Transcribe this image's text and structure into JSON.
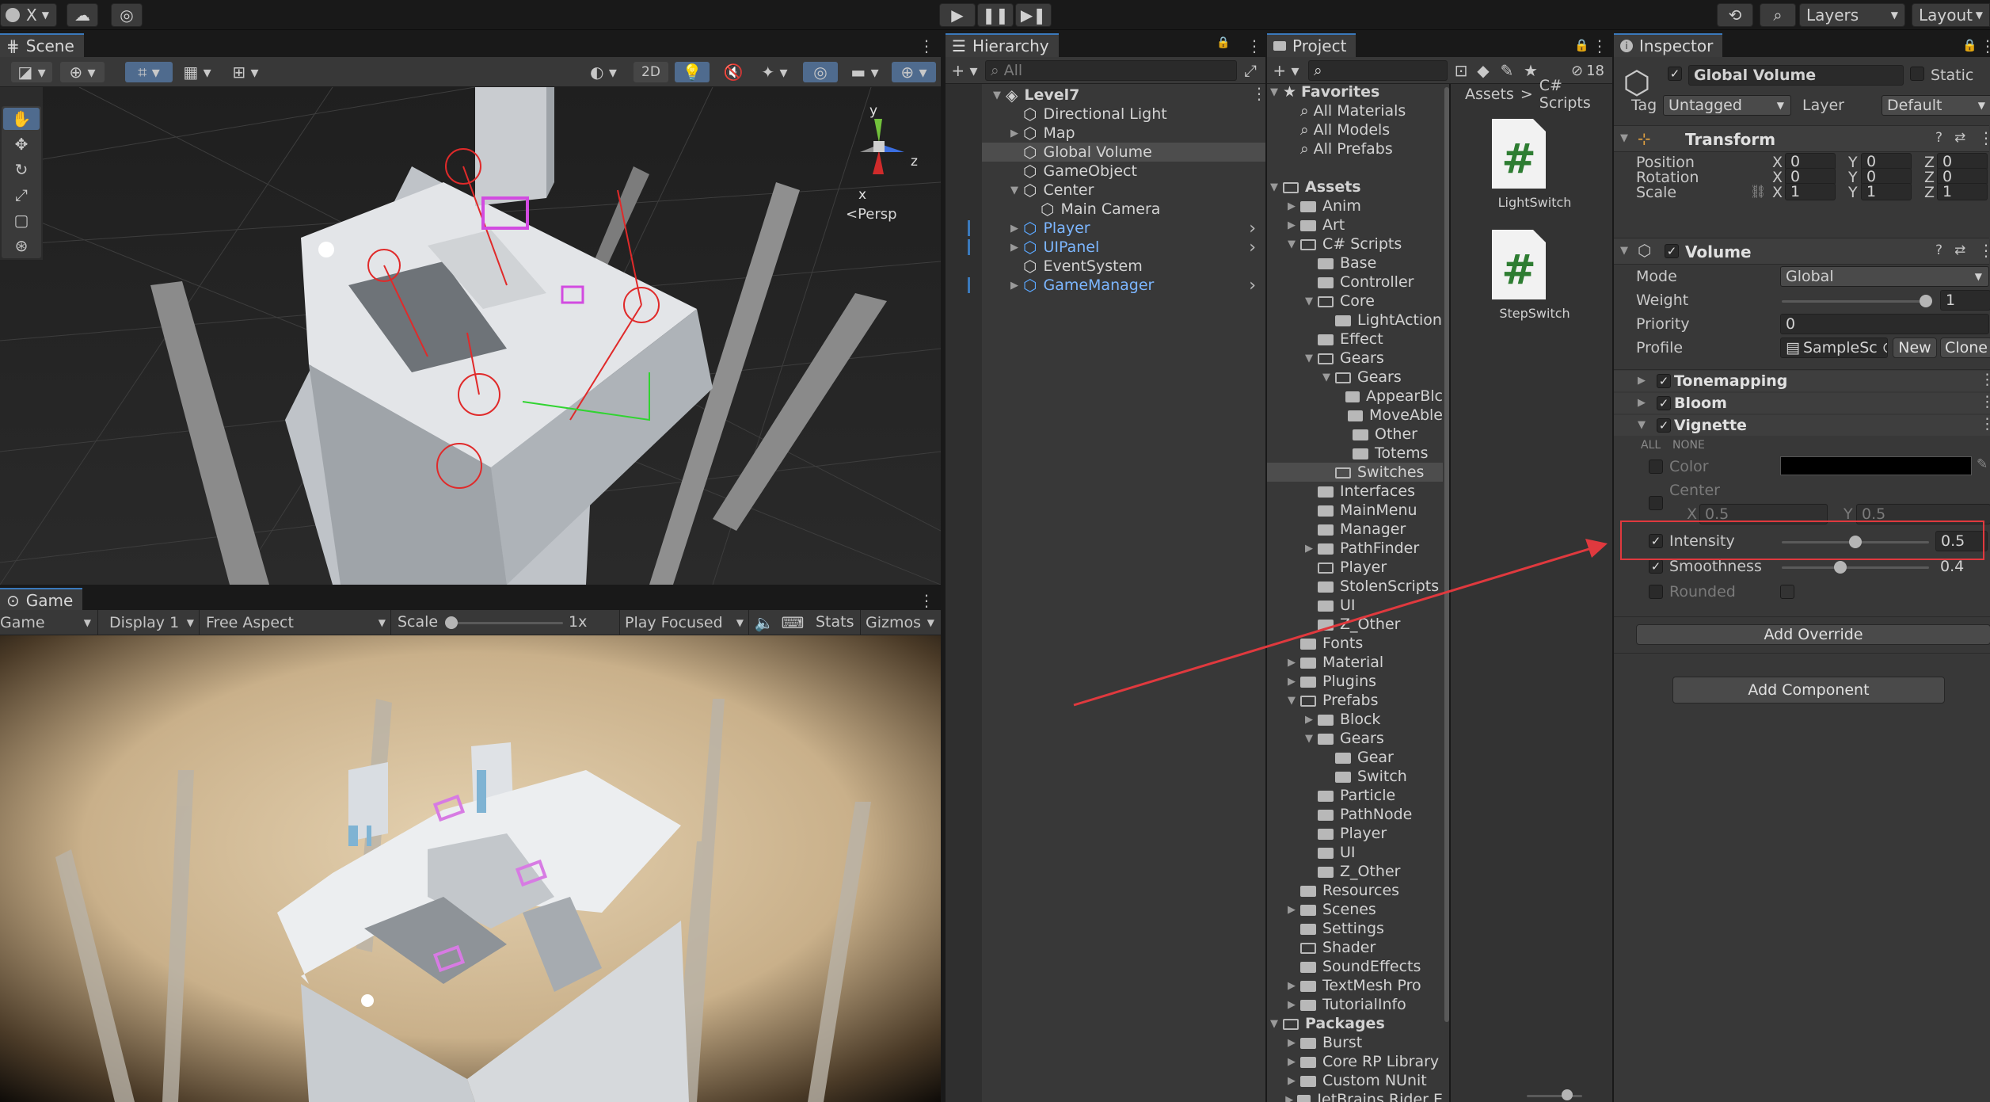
{
  "toolbar": {
    "account": "X",
    "layers": "Layers",
    "layout": "Layout"
  },
  "scene": {
    "tab": "Scene",
    "mode2d": "2D",
    "gizmo": {
      "x": "x",
      "y": "y",
      "z": "z",
      "persp": "Persp"
    }
  },
  "game": {
    "tab": "Game",
    "game_dropdown": "Game",
    "display": "Display 1",
    "aspect": "Free Aspect",
    "scale_label": "Scale",
    "scale_value": "1x",
    "play_mode": "Play Focused",
    "stats": "Stats",
    "gizmos": "Gizmos"
  },
  "hierarchy": {
    "tab": "Hierarchy",
    "search_placeholder": "All",
    "items": [
      {
        "label": "Level7",
        "indent": 0,
        "arrow": "▼",
        "icon": "unity-scene-icon",
        "bold": true
      },
      {
        "label": "Directional Light",
        "indent": 1,
        "arrow": "",
        "icon": "gameobject-icon"
      },
      {
        "label": "Map",
        "indent": 1,
        "arrow": "▶",
        "icon": "gameobject-icon"
      },
      {
        "label": "Global Volume",
        "indent": 1,
        "arrow": "",
        "icon": "gameobject-icon",
        "selected": true
      },
      {
        "label": "GameObject",
        "indent": 1,
        "arrow": "",
        "icon": "gameobject-icon"
      },
      {
        "label": "Center",
        "indent": 1,
        "arrow": "▼",
        "icon": "gameobject-icon"
      },
      {
        "label": "Main Camera",
        "indent": 2,
        "arrow": "",
        "icon": "gameobject-icon"
      },
      {
        "label": "Player",
        "indent": 1,
        "arrow": "▶",
        "icon": "prefab-icon",
        "prefab": true
      },
      {
        "label": "UIPanel",
        "indent": 1,
        "arrow": "▶",
        "icon": "prefab-icon",
        "prefab": true
      },
      {
        "label": "EventSystem",
        "indent": 1,
        "arrow": "",
        "icon": "gameobject-icon"
      },
      {
        "label": "GameManager",
        "indent": 1,
        "arrow": "▶",
        "icon": "prefab-icon",
        "prefab": true
      }
    ]
  },
  "project": {
    "tab": "Project",
    "hidden_count": "18",
    "breadcrumb": [
      "Assets",
      "C# Scripts"
    ],
    "tree": [
      {
        "label": "Favorites",
        "indent": 0,
        "arrow": "▼",
        "icon": "star-icon",
        "bold": true
      },
      {
        "label": "All Materials",
        "indent": 1,
        "icon": "search-icon"
      },
      {
        "label": "All Models",
        "indent": 1,
        "icon": "search-icon"
      },
      {
        "label": "All Prefabs",
        "indent": 1,
        "icon": "search-icon"
      },
      {
        "label": "",
        "indent": 0,
        "icon": "spacer"
      },
      {
        "label": "Assets",
        "indent": 0,
        "arrow": "▼",
        "icon": "folder-open",
        "bold": true
      },
      {
        "label": "Anim",
        "indent": 1,
        "arrow": "▶",
        "icon": "folder"
      },
      {
        "label": "Art",
        "indent": 1,
        "arrow": "▶",
        "icon": "folder"
      },
      {
        "label": "C# Scripts",
        "indent": 1,
        "arrow": "▼",
        "icon": "folder-open"
      },
      {
        "label": "Base",
        "indent": 2,
        "icon": "folder"
      },
      {
        "label": "Controller",
        "indent": 2,
        "icon": "folder"
      },
      {
        "label": "Core",
        "indent": 2,
        "arrow": "▼",
        "icon": "folder-open"
      },
      {
        "label": "LightAction",
        "indent": 3,
        "icon": "folder"
      },
      {
        "label": "Effect",
        "indent": 2,
        "icon": "folder"
      },
      {
        "label": "Gears",
        "indent": 2,
        "arrow": "▼",
        "icon": "folder-open"
      },
      {
        "label": "Gears",
        "indent": 3,
        "arrow": "▼",
        "icon": "folder-open"
      },
      {
        "label": "AppearBlc",
        "indent": 4,
        "icon": "folder"
      },
      {
        "label": "MoveAble",
        "indent": 4,
        "icon": "folder"
      },
      {
        "label": "Other",
        "indent": 4,
        "icon": "folder"
      },
      {
        "label": "Totems",
        "indent": 4,
        "icon": "folder"
      },
      {
        "label": "Switches",
        "indent": 3,
        "icon": "folder-open",
        "selected": true
      },
      {
        "label": "Interfaces",
        "indent": 2,
        "icon": "folder"
      },
      {
        "label": "MainMenu",
        "indent": 2,
        "icon": "folder"
      },
      {
        "label": "Manager",
        "indent": 2,
        "icon": "folder"
      },
      {
        "label": "PathFinder",
        "indent": 2,
        "arrow": "▶",
        "icon": "folder"
      },
      {
        "label": "Player",
        "indent": 2,
        "icon": "folder-open"
      },
      {
        "label": "StolenScripts",
        "indent": 2,
        "icon": "folder"
      },
      {
        "label": "UI",
        "indent": 2,
        "icon": "folder"
      },
      {
        "label": "Z_Other",
        "indent": 2,
        "icon": "folder"
      },
      {
        "label": "Fonts",
        "indent": 1,
        "icon": "folder"
      },
      {
        "label": "Material",
        "indent": 1,
        "arrow": "▶",
        "icon": "folder"
      },
      {
        "label": "Plugins",
        "indent": 1,
        "arrow": "▶",
        "icon": "folder"
      },
      {
        "label": "Prefabs",
        "indent": 1,
        "arrow": "▼",
        "icon": "folder-open"
      },
      {
        "label": "Block",
        "indent": 2,
        "arrow": "▶",
        "icon": "folder"
      },
      {
        "label": "Gears",
        "indent": 2,
        "arrow": "▼",
        "icon": "folder"
      },
      {
        "label": "Gear",
        "indent": 3,
        "icon": "folder"
      },
      {
        "label": "Switch",
        "indent": 3,
        "icon": "folder"
      },
      {
        "label": "Particle",
        "indent": 2,
        "icon": "folder"
      },
      {
        "label": "PathNode",
        "indent": 2,
        "icon": "folder"
      },
      {
        "label": "Player",
        "indent": 2,
        "icon": "folder"
      },
      {
        "label": "UI",
        "indent": 2,
        "icon": "folder"
      },
      {
        "label": "Z_Other",
        "indent": 2,
        "icon": "folder"
      },
      {
        "label": "Resources",
        "indent": 1,
        "icon": "folder"
      },
      {
        "label": "Scenes",
        "indent": 1,
        "arrow": "▶",
        "icon": "folder"
      },
      {
        "label": "Settings",
        "indent": 1,
        "icon": "folder"
      },
      {
        "label": "Shader",
        "indent": 1,
        "icon": "folder-open"
      },
      {
        "label": "SoundEffects",
        "indent": 1,
        "icon": "folder"
      },
      {
        "label": "TextMesh Pro",
        "indent": 1,
        "arrow": "▶",
        "icon": "folder"
      },
      {
        "label": "TutorialInfo",
        "indent": 1,
        "arrow": "▶",
        "icon": "folder"
      },
      {
        "label": "Packages",
        "indent": 0,
        "arrow": "▼",
        "icon": "folder-open",
        "bold": true
      },
      {
        "label": "Burst",
        "indent": 1,
        "arrow": "▶",
        "icon": "folder"
      },
      {
        "label": "Core RP Library",
        "indent": 1,
        "arrow": "▶",
        "icon": "folder"
      },
      {
        "label": "Custom NUnit",
        "indent": 1,
        "arrow": "▶",
        "icon": "folder"
      },
      {
        "label": "JetBrains Rider E",
        "indent": 1,
        "arrow": "▶",
        "icon": "folder"
      }
    ],
    "files": [
      {
        "name": "LightSwitch"
      },
      {
        "name": "StepSwitch"
      }
    ]
  },
  "inspector": {
    "tab": "Inspector",
    "object_name": "Global Volume",
    "static_label": "Static",
    "tag_label": "Tag",
    "tag_value": "Untagged",
    "layer_label": "Layer",
    "layer_value": "Default",
    "transform": {
      "title": "Transform",
      "position": {
        "label": "Position",
        "x": "0",
        "y": "0",
        "z": "0"
      },
      "rotation": {
        "label": "Rotation",
        "x": "0",
        "y": "0",
        "z": "0"
      },
      "scale": {
        "label": "Scale",
        "x": "1",
        "y": "1",
        "z": "1"
      }
    },
    "axis": {
      "x": "X",
      "y": "Y",
      "z": "Z"
    },
    "volume": {
      "title": "Volume",
      "mode_label": "Mode",
      "mode_value": "Global",
      "weight_label": "Weight",
      "weight_value": "1",
      "weight_fraction": 1,
      "priority_label": "Priority",
      "priority_value": "0",
      "profile_label": "Profile",
      "profile_value": "SampleSc",
      "new_label": "New",
      "clone_label": "Clone"
    },
    "overrides": {
      "tonemapping": "Tonemapping",
      "bloom": "Bloom",
      "vignette": "Vignette",
      "all": "ALL",
      "none": "NONE",
      "color_label": "Color",
      "color_value": "#000000",
      "center_label": "Center",
      "center_x": "0.5",
      "center_y": "0.5",
      "intensity_label": "Intensity",
      "intensity_value": "0.5",
      "intensity_fraction": 0.5,
      "smoothness_label": "Smoothness",
      "smoothness_value": "0.4",
      "smoothness_fraction": 0.4,
      "rounded_label": "Rounded"
    },
    "add_override": "Add Override",
    "add_component": "Add Component"
  },
  "colors": {
    "accent": "#3a79bb",
    "annotation": "#e0393e",
    "selected_row": "#4d4d4d",
    "prefab_text": "#7cb6ff"
  }
}
